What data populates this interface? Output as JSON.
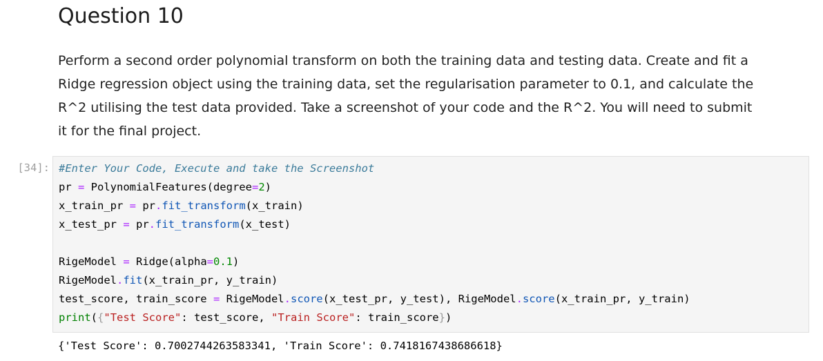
{
  "markdown": {
    "heading": "Question 10",
    "paragraph_lines": [
      "Perform a second order polynomial transform on both the training data and testing data. Create and fit a",
      "Ridge regression object using the training data, set the regularisation parameter to 0.1, and calculate the",
      "R^2 utilising the test data provided. Take a screenshot of your code and the R^2. You will need to submit",
      "it for the final project."
    ]
  },
  "code_cell": {
    "prompt": "[34]:",
    "lines": [
      [
        {
          "t": "#Enter Your Code, Execute and take the Screenshot",
          "c": "comment"
        }
      ],
      [
        {
          "t": "pr ",
          "c": ""
        },
        {
          "t": "=",
          "c": "op"
        },
        {
          "t": " PolynomialFeatures(degree",
          "c": ""
        },
        {
          "t": "=",
          "c": "op"
        },
        {
          "t": "2",
          "c": "num"
        },
        {
          "t": ")",
          "c": ""
        }
      ],
      [
        {
          "t": "x_train_pr ",
          "c": ""
        },
        {
          "t": "=",
          "c": "op"
        },
        {
          "t": " pr",
          "c": ""
        },
        {
          "t": ".",
          "c": "op"
        },
        {
          "t": "fit_transform",
          "c": "attr"
        },
        {
          "t": "(x_train)",
          "c": ""
        }
      ],
      [
        {
          "t": "x_test_pr ",
          "c": ""
        },
        {
          "t": "=",
          "c": "op"
        },
        {
          "t": " pr",
          "c": ""
        },
        {
          "t": ".",
          "c": "op"
        },
        {
          "t": "fit_transform",
          "c": "attr"
        },
        {
          "t": "(x_test)",
          "c": ""
        }
      ],
      [
        {
          "t": "",
          "c": ""
        }
      ],
      [
        {
          "t": "RigeModel ",
          "c": ""
        },
        {
          "t": "=",
          "c": "op"
        },
        {
          "t": " Ridge(alpha",
          "c": ""
        },
        {
          "t": "=",
          "c": "op"
        },
        {
          "t": "0.1",
          "c": "num"
        },
        {
          "t": ")",
          "c": ""
        }
      ],
      [
        {
          "t": "RigeModel",
          "c": ""
        },
        {
          "t": ".",
          "c": "op"
        },
        {
          "t": "fit",
          "c": "attr"
        },
        {
          "t": "(x_train_pr, y_train)",
          "c": ""
        }
      ],
      [
        {
          "t": "test_score, train_score ",
          "c": ""
        },
        {
          "t": "=",
          "c": "op"
        },
        {
          "t": " RigeModel",
          "c": ""
        },
        {
          "t": ".",
          "c": "op"
        },
        {
          "t": "score",
          "c": "attr"
        },
        {
          "t": "(x_test_pr, y_test), RigeModel",
          "c": ""
        },
        {
          "t": ".",
          "c": "op"
        },
        {
          "t": "score",
          "c": "attr"
        },
        {
          "t": "(x_train_pr, y_train)",
          "c": ""
        }
      ],
      [
        {
          "t": "print",
          "c": "builtin"
        },
        {
          "t": "(",
          "c": ""
        },
        {
          "t": "{",
          "c": "brace"
        },
        {
          "t": "\"Test Score\"",
          "c": "str"
        },
        {
          "t": ": test_score, ",
          "c": ""
        },
        {
          "t": "\"Train Score\"",
          "c": "str"
        },
        {
          "t": ": train_score",
          "c": ""
        },
        {
          "t": "}",
          "c": "brace"
        },
        {
          "t": ")",
          "c": ""
        }
      ]
    ],
    "output": "{'Test Score': 0.7002744263583341, 'Train Score': 0.7418167438686618}"
  }
}
